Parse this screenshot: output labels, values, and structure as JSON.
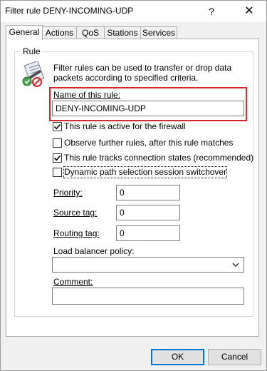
{
  "window": {
    "title": "Filter rule DENY-INCOMING-UDP",
    "help": "?",
    "close": "✕"
  },
  "tabs": [
    {
      "label": "General",
      "active": true
    },
    {
      "label": "Actions"
    },
    {
      "label": "QoS"
    },
    {
      "label": "Stations"
    },
    {
      "label": "Services"
    }
  ],
  "group": {
    "label": "Rule"
  },
  "description": "Filter rules can be used to transfer or drop data packets according to specified criteria.",
  "name_field": {
    "label": "Name of this rule:",
    "value": "DENY-INCOMING-UDP"
  },
  "checkboxes": [
    {
      "label": "This rule is active for the firewall",
      "checked": true
    },
    {
      "label": "Observe further rules, after this rule matches",
      "checked": false
    },
    {
      "label": "This rule tracks connection states (recommended)",
      "checked": true
    },
    {
      "label": "Dynamic path selection session switchover",
      "checked": false
    }
  ],
  "fields": {
    "priority": {
      "label": "Priority:",
      "value": "0"
    },
    "source_tag": {
      "label": "Source tag:",
      "value": "0"
    },
    "routing_tag": {
      "label": "Routing tag:",
      "value": "0"
    },
    "load_balancer": {
      "label": "Load balancer policy:",
      "value": ""
    },
    "comment": {
      "label": "Comment:",
      "value": ""
    }
  },
  "buttons": {
    "ok": "OK",
    "cancel": "Cancel"
  },
  "icons": {
    "help": "help-icon",
    "close": "close-icon",
    "rule": "filter-rule-icon",
    "check": "checkmark-icon",
    "dropdown": "chevron-down-icon"
  },
  "colors": {
    "highlight": "#d6262e",
    "default_button": "#0078d7"
  }
}
